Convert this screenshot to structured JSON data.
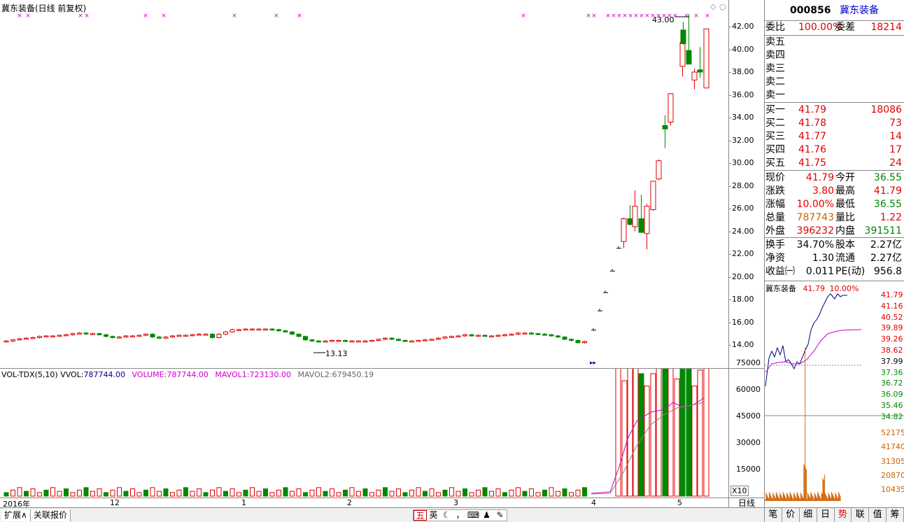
{
  "main": {
    "title": "冀东装备(日线 前复权)",
    "high_label": "43.00",
    "low_label": "13.13",
    "price_ticks": [
      "42.00",
      "40.00",
      "38.00",
      "36.00",
      "34.00",
      "32.00",
      "30.00",
      "28.00",
      "26.00",
      "24.00",
      "22.00",
      "20.00",
      "18.00",
      "16.00",
      "14.00"
    ]
  },
  "volume": {
    "indicator": "VOL-TDX(5,10)",
    "vvol_label": "VVOL:",
    "vvol_value": "787744.00",
    "volume_label": "VOLUME:",
    "volume_value": "787744.00",
    "mavol1_label": "MAVOL1:",
    "mavol1_value": "723130.00",
    "mavol2_label": "MAVOL2:",
    "mavol2_value": "679450.19",
    "ticks": [
      "75000",
      "60000",
      "45000",
      "30000",
      "15000"
    ],
    "unit": "X10"
  },
  "dates": [
    "2016年",
    "12",
    "1",
    "2",
    "3",
    "4",
    "5"
  ],
  "period": "日线",
  "bottom_tabs": [
    "扩展∧",
    "关联报价"
  ],
  "ime": [
    "五",
    "英",
    "☾",
    "，",
    "⌨",
    "♟",
    "🔧"
  ],
  "quote": {
    "code": "000856",
    "name": "冀东装备",
    "weibi_label": "委比",
    "weibi": "100.00%",
    "weicha_label": "委差",
    "weicha": "18214",
    "sells": [
      {
        "label": "卖五",
        "price": "",
        "vol": ""
      },
      {
        "label": "卖四",
        "price": "",
        "vol": ""
      },
      {
        "label": "卖三",
        "price": "",
        "vol": ""
      },
      {
        "label": "卖二",
        "price": "",
        "vol": ""
      },
      {
        "label": "卖一",
        "price": "",
        "vol": ""
      }
    ],
    "buys": [
      {
        "label": "买一",
        "price": "41.79",
        "vol": "18086"
      },
      {
        "label": "买二",
        "price": "41.78",
        "vol": "73"
      },
      {
        "label": "买三",
        "price": "41.77",
        "vol": "14"
      },
      {
        "label": "买四",
        "price": "41.76",
        "vol": "17"
      },
      {
        "label": "买五",
        "price": "41.75",
        "vol": "24"
      }
    ],
    "stats": [
      {
        "l1": "现价",
        "v1": "41.79",
        "c1": "red",
        "l2": "今开",
        "v2": "36.55",
        "c2": "green"
      },
      {
        "l1": "涨跌",
        "v1": "3.80",
        "c1": "red",
        "l2": "最高",
        "v2": "41.79",
        "c2": "red"
      },
      {
        "l1": "涨幅",
        "v1": "10.00%",
        "c1": "red",
        "l2": "最低",
        "v2": "36.55",
        "c2": "green"
      },
      {
        "l1": "总量",
        "v1": "787743",
        "c1": "orange",
        "l2": "量比",
        "v2": "1.22",
        "c2": "red"
      },
      {
        "l1": "外盘",
        "v1": "396232",
        "c1": "red",
        "l2": "内盘",
        "v2": "391511",
        "c2": "green"
      }
    ],
    "fund": [
      {
        "l1": "换手",
        "v1": "34.70%",
        "l2": "股本",
        "v2": "2.27亿"
      },
      {
        "l1": "净资",
        "v1": "1.30",
        "l2": "流通",
        "v2": "2.27亿"
      },
      {
        "l1": "收益㈠",
        "v1": "0.011",
        "l2": "PE(动)",
        "v2": "956.8"
      }
    ]
  },
  "mini": {
    "name": "冀东装备",
    "price": "41.79",
    "pct": "10.00%",
    "price_ticks": [
      {
        "v": "41.79",
        "c": "red"
      },
      {
        "v": "41.16",
        "c": "red"
      },
      {
        "v": "40.52",
        "c": "red"
      },
      {
        "v": "39.89",
        "c": "red"
      },
      {
        "v": "39.26",
        "c": "red"
      },
      {
        "v": "38.62",
        "c": "red"
      },
      {
        "v": "37.99",
        "c": "dark"
      },
      {
        "v": "37.36",
        "c": "green"
      },
      {
        "v": "36.72",
        "c": "green"
      },
      {
        "v": "36.09",
        "c": "green"
      },
      {
        "v": "35.46",
        "c": "green"
      },
      {
        "v": "34.82",
        "c": "green"
      }
    ],
    "vol_ticks": [
      "52175",
      "41740",
      "31305",
      "20870",
      "10435"
    ]
  },
  "right_tabs": [
    "笔",
    "价",
    "细",
    "日",
    "势",
    "联",
    "值",
    "筹"
  ],
  "colors": {
    "up": "#e00000",
    "down": "#008800",
    "ma": "#cc00cc",
    "line": "#000080"
  }
}
